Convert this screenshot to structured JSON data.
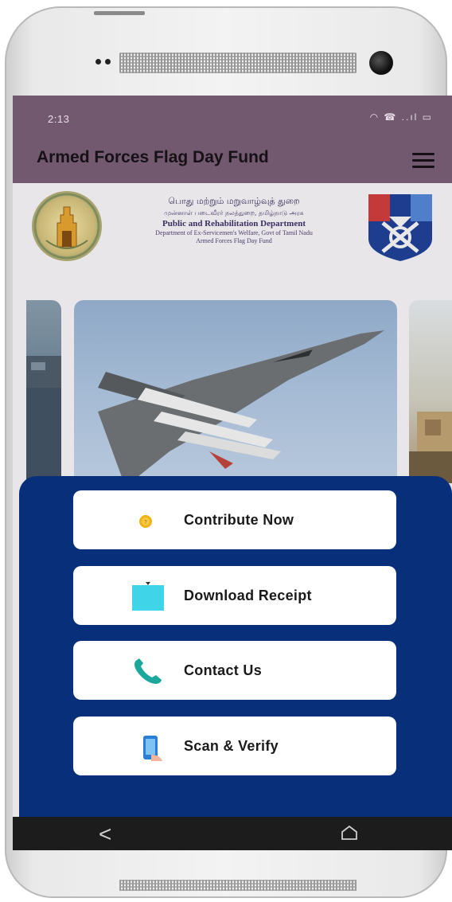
{
  "status_bar": {
    "time": "2:13",
    "icons_text": "◠ ☎ ..ıl ▭",
    "icons": [
      "wifi-icon",
      "call-icon",
      "signal-icon",
      "battery-icon"
    ]
  },
  "app_bar": {
    "title": "Armed Forces Flag Day Fund",
    "menu_icon": "hamburger-menu-icon",
    "background_color": "#73596f"
  },
  "banner": {
    "tamil_line1": "பொது மற்றும் மறுவாழ்வுத் துறை",
    "tamil_line2": "முன்னாள் படைவீரர் நலத்துறை, தமிழ்நாடு அரசு",
    "department": "Public and Rehabilitation Department",
    "subtitle": "Department of  Ex-Servicemen's  Welfare, Govt of  Tamil Nadu",
    "fund": "Armed Forces Flag Day Fund",
    "left_emblem": "tamil-nadu-emblem-icon",
    "right_emblem": "armed-forces-crest-icon"
  },
  "carousel": {
    "slides": [
      "warship-slide",
      "fighter-jet-slide",
      "tank-slide"
    ]
  },
  "actions": [
    {
      "label": "Contribute Now",
      "icon": "coin-icon"
    },
    {
      "label": "Download Receipt",
      "icon": "receipt-icon"
    },
    {
      "label": "Contact Us",
      "icon": "phone-icon"
    },
    {
      "label": "Scan & Verify",
      "icon": "scan-phone-icon"
    }
  ],
  "nav": {
    "back_glyph": "<",
    "back_icon": "back-icon",
    "home_icon": "home-icon"
  },
  "colors": {
    "sheet": "#08307a",
    "accent_cyan": "#3fd4e8",
    "coin": "#f0b419"
  }
}
